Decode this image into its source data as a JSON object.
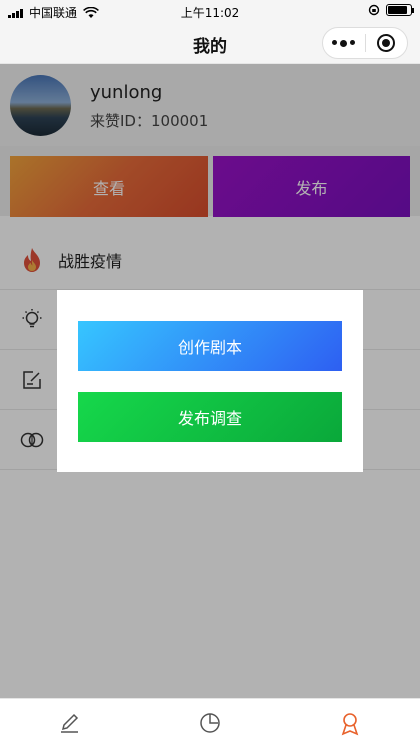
{
  "status_bar": {
    "carrier": "中国联通",
    "time": "上午11:02"
  },
  "nav": {
    "title": "我的"
  },
  "profile": {
    "username": "yunlong",
    "id_label": "来赞ID：",
    "id_value": "100001"
  },
  "actions": {
    "view_label": "查看",
    "publish_label": "发布"
  },
  "menu": {
    "items": [
      {
        "label": "战胜疫情",
        "icon": "flame-icon"
      },
      {
        "label": "",
        "icon": "lightbulb-icon"
      },
      {
        "label": "",
        "icon": "edit-note-icon"
      },
      {
        "label": "",
        "icon": "globe-icon"
      }
    ]
  },
  "modal": {
    "create_script_label": "创作剧本",
    "publish_survey_label": "发布调查"
  },
  "tabbar": {
    "tabs": [
      {
        "icon": "pen-icon"
      },
      {
        "icon": "clock-icon"
      },
      {
        "icon": "user-badge-icon"
      }
    ]
  },
  "colors": {
    "view_gradient": [
      "#f3a53d",
      "#d94d2e"
    ],
    "publish_gradient": [
      "#9a12c8",
      "#7a10bf"
    ],
    "script_gradient": [
      "#36c6ff",
      "#2e5ff2"
    ],
    "survey_gradient": [
      "#16d84b",
      "#0aa83a"
    ],
    "active_tab": "#e8622c"
  }
}
